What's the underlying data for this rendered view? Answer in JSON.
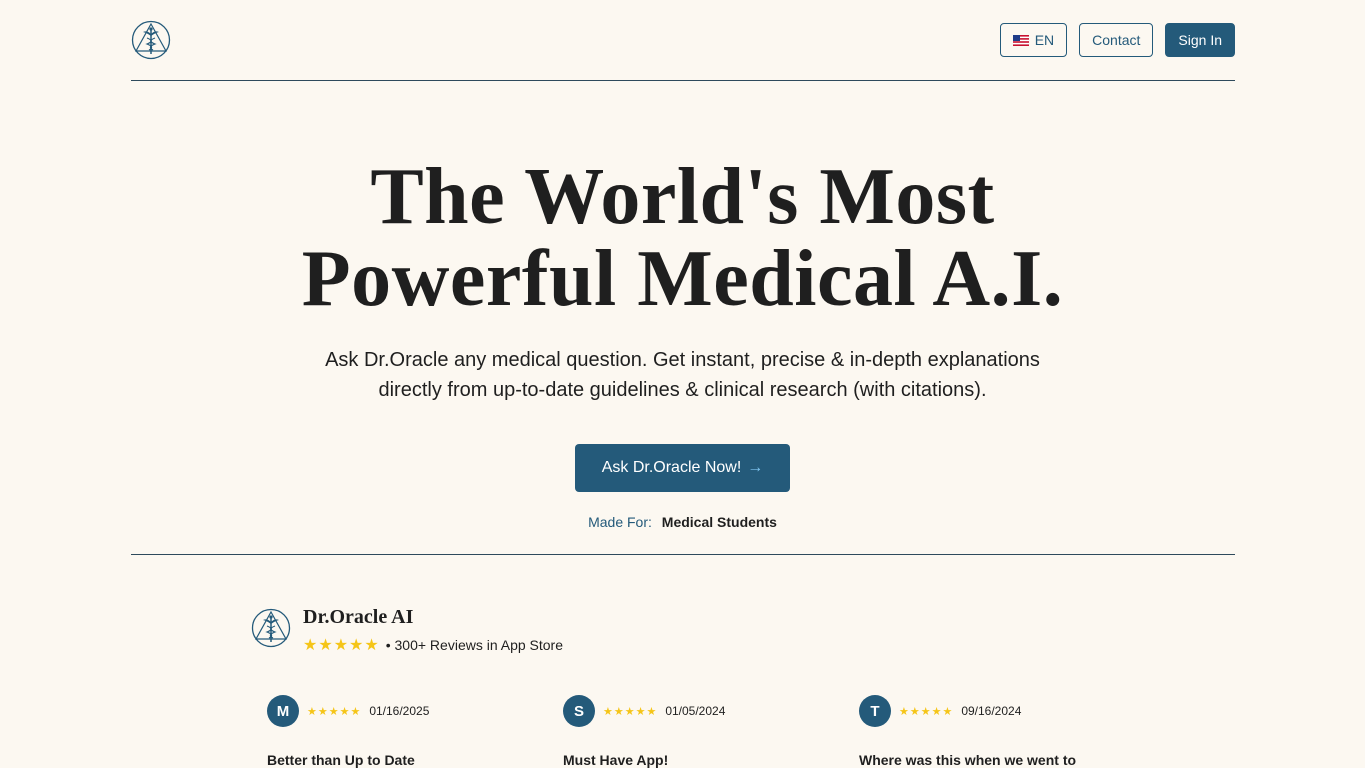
{
  "header": {
    "language_label": "EN",
    "contact_label": "Contact",
    "signin_label": "Sign In"
  },
  "hero": {
    "title_line1": "The World's Most",
    "title_line2": "Powerful Medical A.I.",
    "subtitle_line1": "Ask Dr.Oracle any medical question. Get instant, precise & in-depth explanations",
    "subtitle_line2": "directly from up-to-date guidelines & clinical research (with citations).",
    "cta_label": "Ask Dr.Oracle Now!",
    "cta_arrow": "→",
    "made_for_label": "Made For:",
    "made_for_value": "Medical Students"
  },
  "reviews": {
    "brand_name": "Dr.Oracle AI",
    "stars": "★★★★★",
    "summary": "• 300+ Reviews in App Store",
    "rating": 5,
    "items": [
      {
        "initial": "M",
        "stars": "★★★★★",
        "date": "01/16/2025",
        "title": "Better than Up to Date"
      },
      {
        "initial": "S",
        "stars": "★★★★★",
        "date": "01/05/2024",
        "title": "Must Have App!"
      },
      {
        "initial": "T",
        "stars": "★★★★★",
        "date": "09/16/2024",
        "title": "Where was this when we went to school?"
      }
    ]
  },
  "colors": {
    "background": "#fcf8f1",
    "accent": "#245a7a",
    "star": "#f5c518",
    "text": "#1f1f1f"
  },
  "icons": {
    "logo": "caduceus-logo-icon",
    "flag": "us-flag-icon",
    "arrow": "arrow-right-icon",
    "star": "star-icon"
  }
}
